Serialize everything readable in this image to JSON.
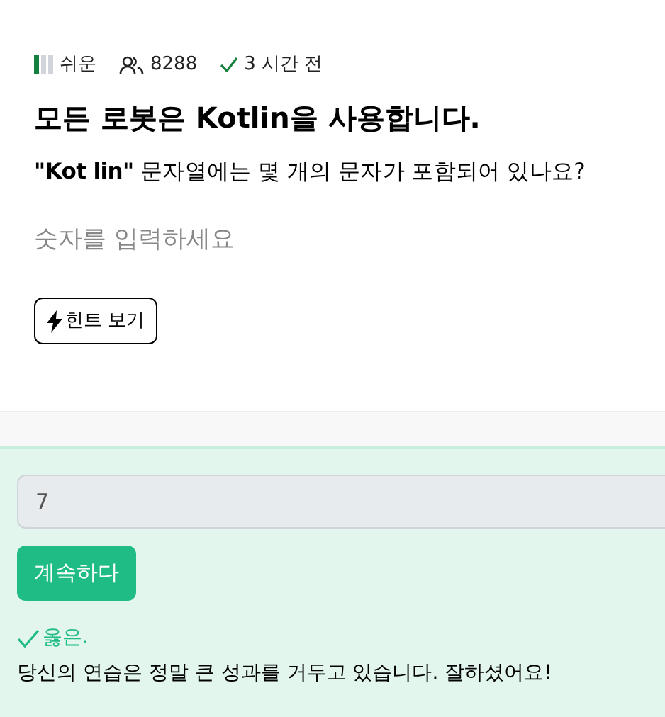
{
  "meta": {
    "difficulty": {
      "label": "쉬운",
      "level": 0.33
    },
    "solvers": "8288",
    "time": "3 시간 전"
  },
  "title": "모든 로봇은 Kotlin을 사용합니다.",
  "question": "**\"Kot lin\"** 문자열에는 몇 개의 문자가 포함되어 있나요?",
  "answer_prompt": "숫자를 입력하세요",
  "hint_button": "힌트 보기",
  "answer": {
    "value": "7",
    "disabled": true
  },
  "continue_button": "계속하다",
  "feedback": {
    "correct": true,
    "verdict": "옳은.",
    "message": "당신의 연습은 정말 큰 성과를 거두고 있습니다. 잘하셨어요!"
  }
}
